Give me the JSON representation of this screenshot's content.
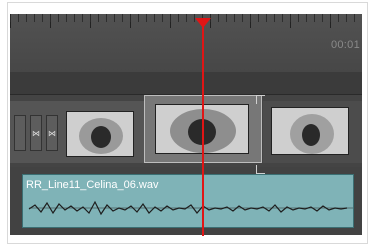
{
  "ruler": {
    "timecode": "00:01"
  },
  "video_track": {
    "mini_icons": [
      "⋈",
      "⋈"
    ]
  },
  "audio_track": {
    "clip_name": "RR_Line11_Celina_06.wav"
  },
  "colors": {
    "playhead": "#e01515",
    "audio_clip": "#7fb3b7"
  }
}
